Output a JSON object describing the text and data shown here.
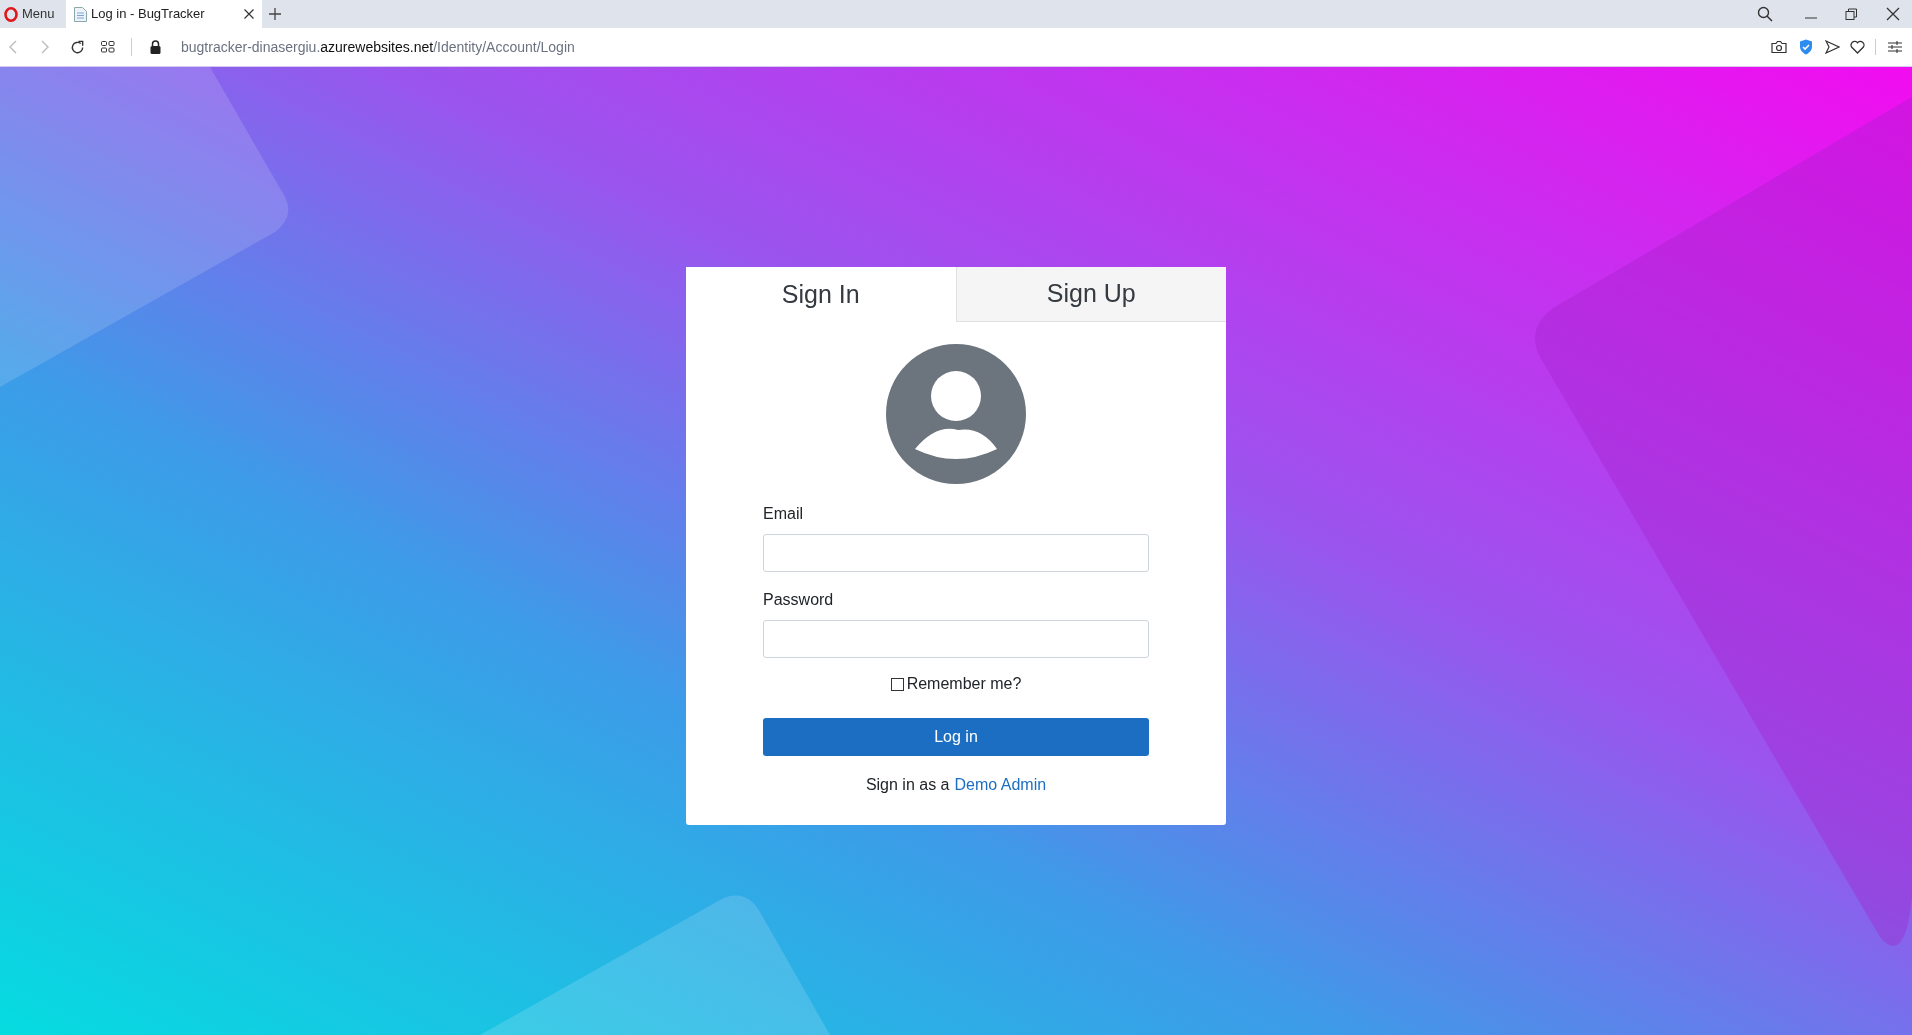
{
  "browser": {
    "menu_label": "Menu",
    "tabs": [
      {
        "title": "Log in - BugTracker",
        "selected": true
      }
    ],
    "url": [
      {
        "text": "bugtracker-dinasergiu.",
        "emphasis": false
      },
      {
        "text": "azurewebsites.net",
        "emphasis": true
      },
      {
        "text": "/Identity/Account/Login",
        "emphasis": false
      }
    ]
  },
  "card": {
    "tabs": [
      {
        "label": "Sign In",
        "selected": true
      },
      {
        "label": "Sign Up",
        "selected": false
      }
    ],
    "fields": [
      {
        "label": "Email"
      },
      {
        "label": "Password"
      }
    ],
    "remember": {
      "label": "Remember me?",
      "checked": false
    },
    "submit": "Log in",
    "footer": {
      "text": "Sign in as a",
      "link": "Demo Admin"
    }
  }
}
